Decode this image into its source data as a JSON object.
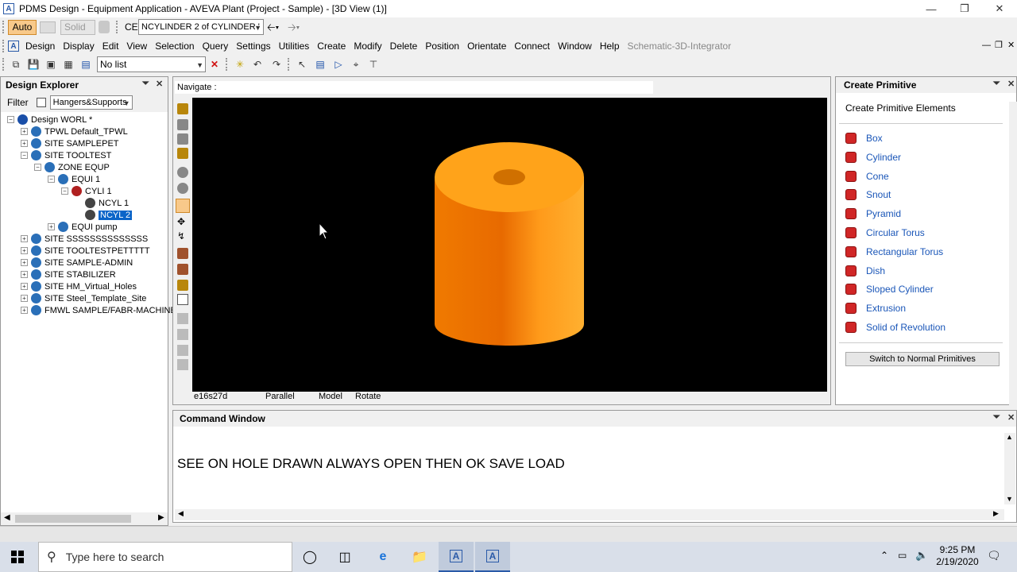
{
  "window": {
    "title": "PDMS Design - Equipment Application - AVEVA Plant (Project - Sample) - [3D View (1)]"
  },
  "toolbar1": {
    "auto_label": "Auto",
    "solid_label": "Solid",
    "ce_label": "CE",
    "ce_value": "NCYLINDER 2 of CYLINDER '"
  },
  "menu": [
    "Design",
    "Display",
    "Edit",
    "View",
    "Selection",
    "Query",
    "Settings",
    "Utilities",
    "Create",
    "Modify",
    "Delete",
    "Position",
    "Orientate",
    "Connect",
    "Window",
    "Help",
    "Schematic-3D-Integrator"
  ],
  "toolbar2": {
    "list_value": "No list"
  },
  "explorer": {
    "title": "Design Explorer",
    "filter_label": "Filter",
    "filter_value": "Hangers&Supports",
    "tree": [
      {
        "label": "Design WORL *",
        "level": 0,
        "exp": "−"
      },
      {
        "label": "TPWL Default_TPWL",
        "level": 1,
        "exp": "+"
      },
      {
        "label": "SITE SAMPLEPET",
        "level": 1,
        "exp": "+"
      },
      {
        "label": "SITE TOOLTEST",
        "level": 1,
        "exp": "−"
      },
      {
        "label": "ZONE EQUP",
        "level": 2,
        "exp": "−"
      },
      {
        "label": "EQUI 1",
        "level": 3,
        "exp": "−"
      },
      {
        "label": "CYLI 1",
        "level": 4,
        "exp": "−"
      },
      {
        "label": "NCYL 1",
        "level": 5,
        "exp": ""
      },
      {
        "label": "NCYL 2",
        "level": 5,
        "exp": "",
        "selected": true
      },
      {
        "label": "EQUI pump",
        "level": 3,
        "exp": "+"
      },
      {
        "label": "SITE SSSSSSSSSSSSSS",
        "level": 1,
        "exp": "+"
      },
      {
        "label": "SITE TOOLTESTPETTTTT",
        "level": 1,
        "exp": "+"
      },
      {
        "label": "SITE SAMPLE-ADMIN",
        "level": 1,
        "exp": "+"
      },
      {
        "label": "SITE STABILIZER",
        "level": 1,
        "exp": "+"
      },
      {
        "label": "SITE HM_Virtual_Holes",
        "level": 1,
        "exp": "+"
      },
      {
        "label": "SITE Steel_Template_Site",
        "level": 1,
        "exp": "+"
      },
      {
        "label": "FMWL SAMPLE/FABR-MACHINE",
        "level": 1,
        "exp": "+"
      }
    ]
  },
  "view": {
    "navigate_label": "Navigate :",
    "status": [
      "e16s27d",
      "Parallel",
      "Model",
      "Rotate"
    ]
  },
  "primitive": {
    "title": "Create Primitive",
    "subtitle": "Create Primitive Elements",
    "items": [
      "Box",
      "Cylinder",
      "Cone",
      "Snout",
      "Pyramid",
      "Circular Torus",
      "Rectangular Torus",
      "Dish",
      "Sloped Cylinder",
      "Extrusion",
      "Solid of Revolution"
    ],
    "switch_label": "Switch to Normal Primitives"
  },
  "command": {
    "title": "Command Window",
    "text": "SEE ON HOLE DRAWN ALWAYS OPEN THEN OK SAVE LOAD"
  },
  "taskbar": {
    "search_placeholder": "Type here to search",
    "time": "9:25 PM",
    "date": "2/19/2020"
  }
}
